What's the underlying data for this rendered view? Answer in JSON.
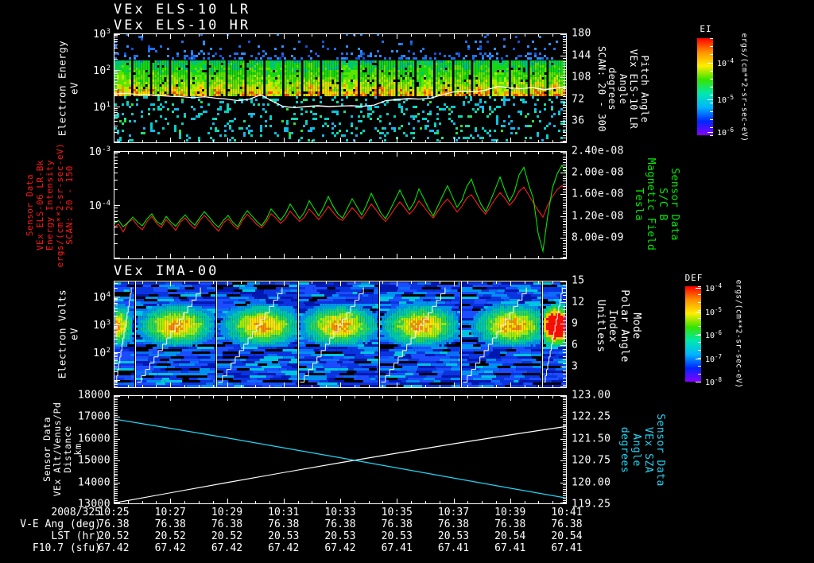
{
  "colors": {
    "white": "#ffffff",
    "red": "#ff1a1a",
    "green": "#00e800",
    "cyan": "#22d5f5",
    "blue_dot": "#2f8fff",
    "bg": "#000000"
  },
  "chart_data": [
    {
      "type": "heatmap",
      "titles": [
        "VEx ELS-10 LR",
        "VEx ELS-10 HR"
      ],
      "y_axis": {
        "label_lines": [
          "Electron Energy",
          "eV"
        ],
        "scale": "log",
        "range_exp": [
          3,
          0
        ],
        "tick_exps": [
          3,
          2,
          1
        ],
        "tick_labels": [
          "10^3",
          "10^2",
          "10^1"
        ]
      },
      "y2_axis": {
        "label_lines": [
          "Pitch Angle",
          "VEx ELS-10 LR",
          "Angle",
          "degrees",
          "SCAN: 20 - 300"
        ],
        "range": [
          180,
          0
        ],
        "tick_values": [
          180,
          144,
          108,
          72,
          36
        ],
        "major": 36,
        "minor": 4.5
      },
      "x_axis": {
        "start": "10:25",
        "end": "10:41"
      },
      "scan_blocks": 24,
      "main_band_ev": [
        20,
        180
      ],
      "overlay_trace_ev": [
        22,
        23,
        21.5,
        21,
        20,
        19,
        18.5,
        17.5,
        18.5,
        17,
        16,
        14.5,
        16,
        21,
        14,
        10,
        9.3,
        10,
        10.5,
        10,
        10.3,
        10.6,
        10.2,
        11,
        14.5,
        15.5,
        16.5,
        16,
        17,
        21,
        25,
        26,
        25.5,
        29,
        36,
        32,
        31,
        33,
        29,
        32,
        34
      ],
      "colorbar": "EI"
    },
    {
      "type": "line",
      "y_axis": {
        "label_lines": [
          "Sensor Data",
          "VEx ELS-06 LR-Bk",
          "Energy Intensity",
          "ergs/(cm**2-sr-sec-eV)",
          "SCAN: 20 - 150"
        ],
        "color_key": "red",
        "scale": "log",
        "range_exp": [
          -3,
          -5
        ],
        "tick_exps": [
          -3,
          -4
        ],
        "tick_labels": [
          "10^-3",
          "10^-4"
        ]
      },
      "y2_axis": {
        "label_lines": [
          "Sensor Data",
          "S/C B",
          "Magnetic Field",
          "Tesla"
        ],
        "color_key": "green",
        "range": [
          2.4e-08,
          4e-09
        ],
        "tick_values": [
          2.4e-08,
          2e-08,
          1.6e-08,
          1.2e-08,
          8e-09
        ],
        "tick_labels": [
          "2.40e-08",
          "2.00e-08",
          "1.60e-08",
          "1.20e-08",
          "8.00e-09"
        ],
        "major": 4e-09,
        "minor": 5e-10
      },
      "series": [
        {
          "name": "VEx ELS-06 LR-Bk Energy Intensity",
          "color_key": "red",
          "axis": "left",
          "unit": "ergs/(cm**2-sr-sec-eV)",
          "scale": 1e-05,
          "values": [
            3.8,
            4.5,
            3.2,
            4.8,
            5.5,
            4.2,
            3.5,
            5.0,
            6.2,
            4.6,
            3.9,
            5.4,
            4.4,
            3.4,
            4.9,
            5.8,
            4.5,
            3.7,
            5.1,
            6.5,
            5.2,
            4.1,
            3.3,
            4.7,
            5.6,
            4.3,
            3.6,
            5.2,
            6.8,
            5.5,
            4.4,
            3.8,
            4.9,
            7.0,
            5.8,
            4.6,
            5.6,
            7.8,
            6.2,
            5.0,
            6.0,
            8.5,
            6.8,
            5.4,
            7.0,
            9.5,
            7.4,
            5.8,
            5.2,
            6.8,
            9.0,
            7.2,
            5.6,
            7.6,
            10.5,
            8.2,
            6.2,
            5.0,
            6.5,
            8.8,
            11.5,
            9.0,
            6.8,
            8.5,
            12.0,
            9.5,
            7.2,
            5.8,
            7.8,
            10.5,
            13.0,
            10.0,
            7.5,
            9.5,
            13.5,
            15.5,
            11.5,
            8.5,
            6.8,
            9.5,
            13.0,
            17.0,
            13.5,
            10.0,
            12.5,
            18.0,
            21.5,
            15.5,
            11.0,
            8.0,
            6.0,
            10.0,
            14.5,
            19.5,
            23.0,
            19.0
          ]
        },
        {
          "name": "S/C B Magnetic Field",
          "color_key": "green",
          "axis": "right",
          "unit": "Tesla",
          "scale": 1e-09,
          "values": [
            10.5,
            11.2,
            10.0,
            10.8,
            11.8,
            10.9,
            10.2,
            11.5,
            12.4,
            11.0,
            10.4,
            11.9,
            10.9,
            10.1,
            11.3,
            12.2,
            11.1,
            10.3,
            11.6,
            12.8,
            11.8,
            10.7,
            9.9,
            11.2,
            12.1,
            10.8,
            10.0,
            11.7,
            13.0,
            12.0,
            11.0,
            10.2,
            11.4,
            13.3,
            12.3,
            11.2,
            12.4,
            14.2,
            12.9,
            11.5,
            12.7,
            14.8,
            13.4,
            12.0,
            13.6,
            15.6,
            13.8,
            12.4,
            11.6,
            13.4,
            15.2,
            13.7,
            12.2,
            14.0,
            16.2,
            14.4,
            12.6,
            11.5,
            13.2,
            15.0,
            16.8,
            15.0,
            13.1,
            14.5,
            17.0,
            15.3,
            13.4,
            12.0,
            13.9,
            15.8,
            17.6,
            15.6,
            13.6,
            14.9,
            17.4,
            18.8,
            16.3,
            14.2,
            12.8,
            14.8,
            17.0,
            19.2,
            16.8,
            14.7,
            16.4,
            19.6,
            21.0,
            17.8,
            15.2,
            8.8,
            5.5,
            12.0,
            17.2,
            19.8,
            21.4,
            19.6
          ]
        }
      ]
    },
    {
      "type": "heatmap",
      "titles": [
        "VEx IMA-00"
      ],
      "y_axis": {
        "label_lines": [
          "Electron Volts",
          "eV"
        ],
        "scale": "log",
        "range_exp": [
          4.57,
          0.71
        ],
        "tick_exps": [
          4,
          3,
          2
        ],
        "tick_labels": [
          "10^4",
          "10^3",
          "10^2"
        ]
      },
      "y2_axis": {
        "label_lines": [
          "Mode",
          "Polar Angle",
          "Index",
          "Unitless"
        ],
        "range": [
          15,
          0
        ],
        "tick_values": [
          15,
          12,
          9,
          6,
          3
        ],
        "major": 3,
        "minor": 0.5
      },
      "blocks": 6,
      "blob_center_ev": 1000,
      "colorbar": "DEF"
    },
    {
      "type": "line",
      "y_axis": {
        "label_lines": [
          "Sensor Data",
          "VEx Alt/Venus/Pd",
          "Distance",
          "km"
        ],
        "range": [
          18000,
          13000
        ],
        "tick_values": [
          18000,
          17000,
          16000,
          15000,
          14000,
          13000
        ],
        "tick_labels": [
          "18000",
          "17000",
          "16000",
          "15000",
          "14000",
          "13000"
        ],
        "major": 1000,
        "minor": 100
      },
      "y2_axis": {
        "label_lines": [
          "Sensor Data",
          "VEx SZA",
          "Angle",
          "degrees"
        ],
        "color_key": "cyan",
        "range": [
          123.0,
          119.25
        ],
        "tick_values": [
          123.0,
          122.25,
          121.5,
          120.75,
          120.0,
          119.25
        ],
        "tick_labels": [
          "123.00",
          "122.25",
          "121.50",
          "120.75",
          "120.00",
          "119.25"
        ],
        "major": 0.75,
        "minor": 0.075
      },
      "series": [
        {
          "name": "VEx Alt/Venus/Pd Distance",
          "color_key": "white",
          "axis": "left",
          "unit": "km",
          "values": [
            13050,
            13520,
            13990,
            14450,
            14900,
            15340,
            15770,
            16180,
            16570
          ]
        },
        {
          "name": "VEx SZA Angle",
          "color_key": "cyan",
          "axis": "right",
          "unit": "degrees",
          "values": [
            122.18,
            121.86,
            121.53,
            121.19,
            120.85,
            120.5,
            120.15,
            119.8,
            119.46
          ]
        }
      ]
    }
  ],
  "colorbars": {
    "EI": {
      "title": "EI",
      "tick_labels": [
        "10^-4",
        "10^-5",
        "10^-6"
      ],
      "tick_fracs": [
        0.25,
        0.63,
        0.97
      ],
      "units": "ergs/(cm**2-sr-sec-eV)",
      "stops": [
        "#ff0000",
        "#ff9100",
        "#ffee00",
        "#36e400",
        "#00e8b0",
        "#00b4ff",
        "#0026ff",
        "#8800ff"
      ]
    },
    "DEF": {
      "title": "DEF",
      "tick_labels": [
        "10^-4",
        "10^-5",
        "10^-6",
        "10^-7",
        "10^-8"
      ],
      "tick_fracs": [
        0.02,
        0.265,
        0.51,
        0.755,
        1.0
      ],
      "units": "ergs/(cm**2-sr-sec-eV)",
      "stops": [
        "#ff0000",
        "#ff9100",
        "#ffee00",
        "#36e400",
        "#00e8b0",
        "#00b4ff",
        "#0026ff",
        "#8800ff"
      ]
    }
  },
  "time_axis": {
    "date": "2008/325",
    "times": [
      "10:25",
      "10:27",
      "10:29",
      "10:31",
      "10:33",
      "10:35",
      "10:37",
      "10:39",
      "10:41"
    ]
  },
  "stats_rows": [
    {
      "label": "V-E Ang (deg)",
      "values": [
        "76.38",
        "76.38",
        "76.38",
        "76.38",
        "76.38",
        "76.38",
        "76.38",
        "76.38",
        "76.38"
      ]
    },
    {
      "label": "LST (hr)",
      "values": [
        "20.52",
        "20.52",
        "20.52",
        "20.53",
        "20.53",
        "20.53",
        "20.53",
        "20.54",
        "20.54"
      ]
    },
    {
      "label": "F10.7 (sfu)",
      "values": [
        "67.42",
        "67.42",
        "67.42",
        "67.42",
        "67.42",
        "67.41",
        "67.41",
        "67.41",
        "67.41"
      ]
    }
  ]
}
